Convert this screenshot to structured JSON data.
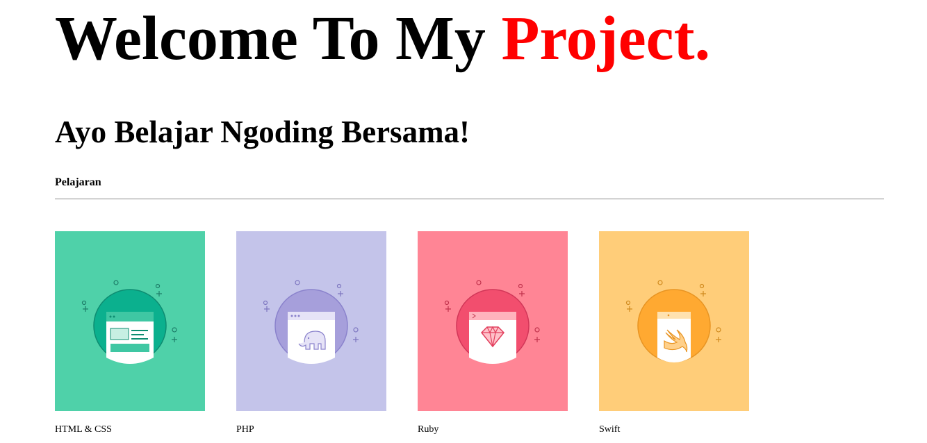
{
  "header": {
    "title_main": "Welcome To My ",
    "title_accent": "Project.",
    "accent_color": "#ff0000",
    "subtitle": "Ayo Belajar Ngoding Bersama!",
    "section_label": "Pelajaran"
  },
  "courses": [
    {
      "label": "HTML & CSS",
      "bg": "#4fd1a9",
      "circle": "#0bb08e",
      "icon": "browser-window-icon"
    },
    {
      "label": "PHP",
      "bg": "#c4c4ea",
      "circle": "#a69fdb",
      "icon": "php-elephant-icon"
    },
    {
      "label": "Ruby",
      "bg": "#ff8595",
      "circle": "#f24e6e",
      "icon": "ruby-gem-icon"
    },
    {
      "label": "Swift",
      "bg": "#ffcd79",
      "circle": "#ffa931",
      "icon": "swift-bird-icon"
    }
  ]
}
